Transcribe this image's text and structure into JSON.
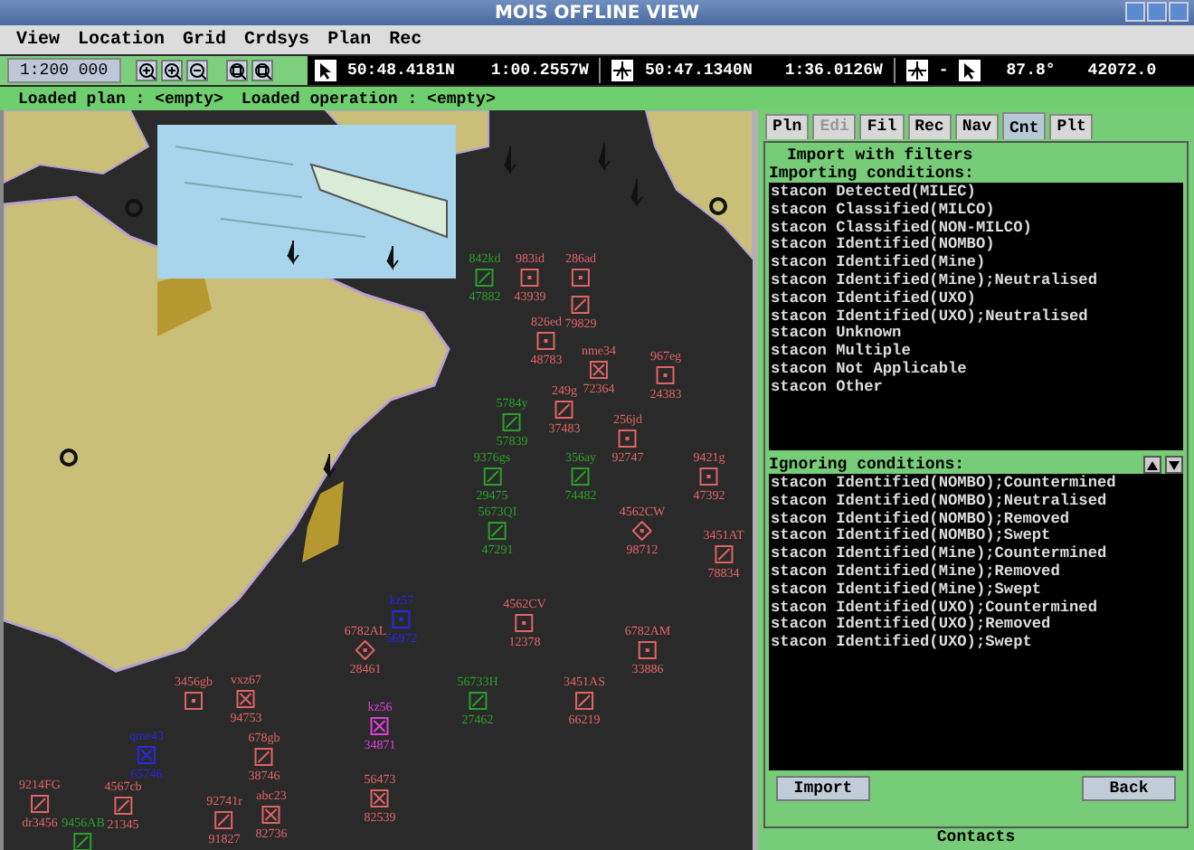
{
  "window": {
    "title": "MOIS OFFLINE VIEW"
  },
  "menu": [
    "View",
    "Location",
    "Grid",
    "Crdsys",
    "Plan",
    "Rec"
  ],
  "toolbar": {
    "scale": "1:200 000",
    "cursor_lat": "50:48.4181N",
    "cursor_lon": "1:00.2557W",
    "ref_lat": "50:47.1340N",
    "ref_lon": "1:36.0126W",
    "separator": "-",
    "bearing": "87.8°",
    "distance": "42072.0"
  },
  "status": [
    "Loaded plan : <empty>",
    "Loaded operation : <empty>"
  ],
  "map": {
    "contacts": [
      {
        "label": "842kd",
        "number": "47882",
        "color": "#2aa02a",
        "kind": "diag"
      },
      {
        "label": "983id",
        "number": "43939",
        "color": "#e06464",
        "kind": "dot"
      },
      {
        "label": "286ad",
        "color": "#e06464",
        "kind": "dot"
      },
      {
        "number": "79829",
        "color": "#e06464",
        "kind": "diag"
      },
      {
        "label": "826ed",
        "number": "48783",
        "color": "#e06464",
        "kind": "dot"
      },
      {
        "label": "nme34",
        "number": "72364",
        "color": "#e06464",
        "kind": "cross"
      },
      {
        "label": "967eg",
        "number": "24383",
        "color": "#e06464",
        "kind": "dot"
      },
      {
        "label": "5784y",
        "number": "57839",
        "color": "#2aa02a",
        "kind": "diag"
      },
      {
        "label": "249g",
        "number": "37483",
        "color": "#e06464",
        "kind": "diag"
      },
      {
        "label": "256jd",
        "number": "92747",
        "color": "#e06464",
        "kind": "dot"
      },
      {
        "label": "9376gs",
        "number": "29475",
        "color": "#2aa02a",
        "kind": "diag"
      },
      {
        "label": "356ay",
        "number": "74482",
        "color": "#2aa02a",
        "kind": "diag"
      },
      {
        "label": "9421g",
        "number": "47392",
        "color": "#e06464",
        "kind": "dot"
      },
      {
        "label": "5673QI",
        "number": "47291",
        "color": "#2aa02a",
        "kind": "diag"
      },
      {
        "label": "4562CW",
        "number": "98712",
        "color": "#e06464",
        "kind": "diamond"
      },
      {
        "label": "3451AT",
        "number": "78834",
        "color": "#e06464",
        "kind": "diag"
      },
      {
        "label": "kz57",
        "number": "56972",
        "color": "#2828e0",
        "kind": "dot"
      },
      {
        "label": "4562CV",
        "number": "12378",
        "color": "#e06464",
        "kind": "dot"
      },
      {
        "label": "6782AL",
        "number": "28461",
        "color": "#e06464",
        "kind": "diamond"
      },
      {
        "label": "6782AM",
        "number": "33886",
        "color": "#e06464",
        "kind": "dot"
      },
      {
        "label": "3456gb",
        "color": "#e06464",
        "kind": "dot"
      },
      {
        "label": "vxz67",
        "number": "94753",
        "color": "#e06464",
        "kind": "cross"
      },
      {
        "label": "56733H",
        "number": "27462",
        "color": "#2aa02a",
        "kind": "diag"
      },
      {
        "label": "3451AS",
        "number": "66219",
        "color": "#e06464",
        "kind": "diag"
      },
      {
        "label": "kz56",
        "number": "34871",
        "color": "#e040e0",
        "kind": "cross"
      },
      {
        "label": "qme43",
        "number": "65746",
        "color": "#2828e0",
        "kind": "cross"
      },
      {
        "label": "678gb",
        "number": "38746",
        "color": "#e06464",
        "kind": "diag"
      },
      {
        "label": "9214FG",
        "number": "dr3456",
        "color": "#e06464",
        "kind": "diag"
      },
      {
        "label": "4567cb",
        "number": "21345",
        "color": "#e06464",
        "kind": "diag"
      },
      {
        "label": "92741r",
        "number": "91827",
        "color": "#e06464",
        "kind": "diag"
      },
      {
        "label": "abc23",
        "number": "82736",
        "color": "#e06464",
        "kind": "cross"
      },
      {
        "label": "56473",
        "number": "82539",
        "color": "#e06464",
        "kind": "cross"
      },
      {
        "label": "9456AB",
        "color": "#2aa02a",
        "kind": "diag"
      }
    ]
  },
  "panel": {
    "tabs": [
      {
        "label": "Pln",
        "selected": false,
        "disabled": false
      },
      {
        "label": "Edi",
        "selected": false,
        "disabled": true
      },
      {
        "label": "Fil",
        "selected": false,
        "disabled": false
      },
      {
        "label": "Rec",
        "selected": false,
        "disabled": false
      },
      {
        "label": "Nav",
        "selected": false,
        "disabled": false
      },
      {
        "label": "Cnt",
        "selected": true,
        "disabled": false
      },
      {
        "label": "Plt",
        "selected": false,
        "disabled": false
      }
    ],
    "group_title": "Import with filters",
    "importing": {
      "heading": "Importing conditions:",
      "items": [
        "stacon Detected(MILEC)",
        "stacon Classified(MILCO)",
        "stacon Classified(NON-MILCO)",
        "stacon Identified(NOMBO)",
        "stacon Identified(Mine)",
        "stacon Identified(Mine);Neutralised",
        "stacon Identified(UXO)",
        "stacon Identified(UXO);Neutralised",
        "stacon Unknown",
        "stacon Multiple",
        "stacon Not Applicable",
        "stacon Other"
      ]
    },
    "ignoring": {
      "heading": "Ignoring conditions:",
      "items": [
        "stacon Identified(NOMBO);Countermined",
        "stacon Identified(NOMBO);Neutralised",
        "stacon Identified(NOMBO);Removed",
        "stacon Identified(NOMBO);Swept",
        "stacon Identified(Mine);Countermined",
        "stacon Identified(Mine);Removed",
        "stacon Identified(Mine);Swept",
        "stacon Identified(UXO);Countermined",
        "stacon Identified(UXO);Removed",
        "stacon Identified(UXO);Swept"
      ]
    },
    "buttons": [
      "Import",
      "Back"
    ],
    "footer": "Contacts"
  }
}
